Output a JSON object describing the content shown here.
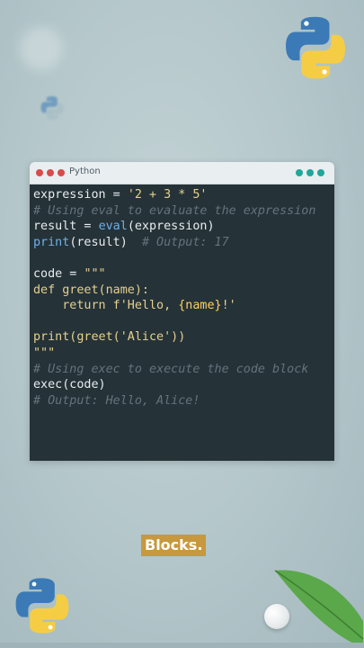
{
  "window": {
    "title": "Python",
    "dot_colors": [
      "#d94b4b",
      "#d94b4b",
      "#d94b4b"
    ],
    "right_dot_color": "#1fa79a"
  },
  "code_lines": [
    [
      {
        "t": "expression = ",
        "c": ""
      },
      {
        "t": "'2 + 3 * 5'",
        "c": "str"
      }
    ],
    [
      {
        "t": "# Using eval to evaluate the expression",
        "c": "cm"
      }
    ],
    [
      {
        "t": "result = ",
        "c": ""
      },
      {
        "t": "eval",
        "c": "fn"
      },
      {
        "t": "(expression)",
        "c": ""
      }
    ],
    [
      {
        "t": "print",
        "c": "fn"
      },
      {
        "t": "(result)  ",
        "c": ""
      },
      {
        "t": "# Output: 17",
        "c": "cm"
      }
    ],
    [
      {
        "t": "",
        "c": ""
      }
    ],
    [
      {
        "t": "code = ",
        "c": ""
      },
      {
        "t": "\"\"\"",
        "c": "str"
      }
    ],
    [
      {
        "t": "def greet(name):",
        "c": "str"
      }
    ],
    [
      {
        "t": "    return f'Hello, ",
        "c": "str"
      },
      {
        "t": "{name}",
        "c": "interp"
      },
      {
        "t": "!'",
        "c": "str"
      }
    ],
    [
      {
        "t": "",
        "c": ""
      }
    ],
    [
      {
        "t": "print(greet('Alice'))",
        "c": "str"
      }
    ],
    [
      {
        "t": "\"\"\"",
        "c": "str"
      }
    ],
    [
      {
        "t": "# Using exec to execute the code block",
        "c": "cm"
      }
    ],
    [
      {
        "t": "exec(code)",
        "c": ""
      }
    ],
    [
      {
        "t": "# Output: Hello, Alice!",
        "c": "cm"
      }
    ]
  ],
  "caption": "Blocks.",
  "colors": {
    "background": "#b3c6ca",
    "editor_bg": "#253238",
    "caption_bg": "#c7983d",
    "python_blue": "#3b7ab6",
    "python_yellow": "#f5cd45"
  },
  "icons": [
    "python-logo-icon",
    "leaf-icon"
  ]
}
